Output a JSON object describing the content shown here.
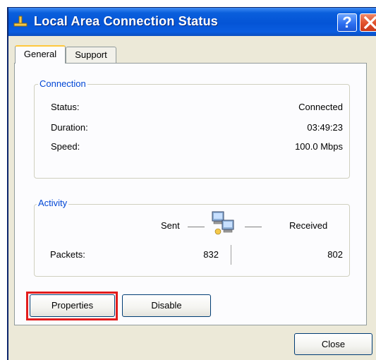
{
  "window": {
    "title": "Local Area Connection Status"
  },
  "tabs": [
    {
      "label": "General"
    },
    {
      "label": "Support"
    }
  ],
  "connection": {
    "group_label": "Connection",
    "status_label": "Status:",
    "status_value": "Connected",
    "duration_label": "Duration:",
    "duration_value": "03:49:23",
    "speed_label": "Speed:",
    "speed_value": "100.0 Mbps"
  },
  "activity": {
    "group_label": "Activity",
    "sent_label": "Sent",
    "received_label": "Received",
    "packets_label": "Packets:",
    "packets_sent": "832",
    "packets_received": "802"
  },
  "buttons": {
    "properties": "Properties",
    "disable": "Disable",
    "close": "Close"
  },
  "colors": {
    "titlebar": "#0454d6",
    "highlight": "#e21c1c",
    "group_label": "#0046d5"
  },
  "icons": {
    "title": "network-connection-icon",
    "activity": "network-computers-icon"
  }
}
